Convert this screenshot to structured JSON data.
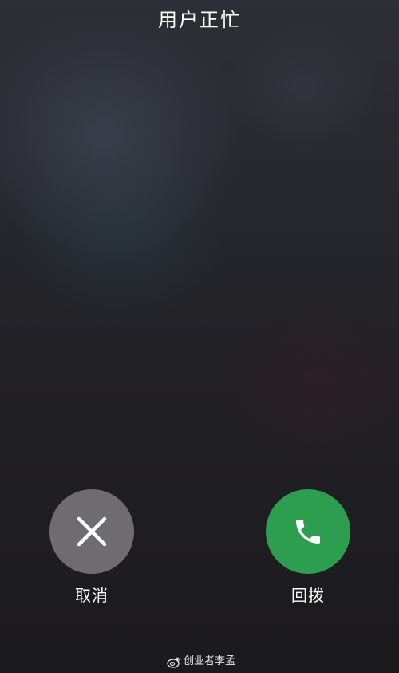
{
  "status": {
    "title": "用户正忙"
  },
  "actions": {
    "cancel": {
      "label": "取消",
      "icon": "close-icon",
      "color": "#6e6c71"
    },
    "redial": {
      "label": "回拨",
      "icon": "phone-icon",
      "color": "#2d9e50"
    }
  },
  "watermark": {
    "text": "创业者李孟",
    "icon": "weibo-logo"
  }
}
